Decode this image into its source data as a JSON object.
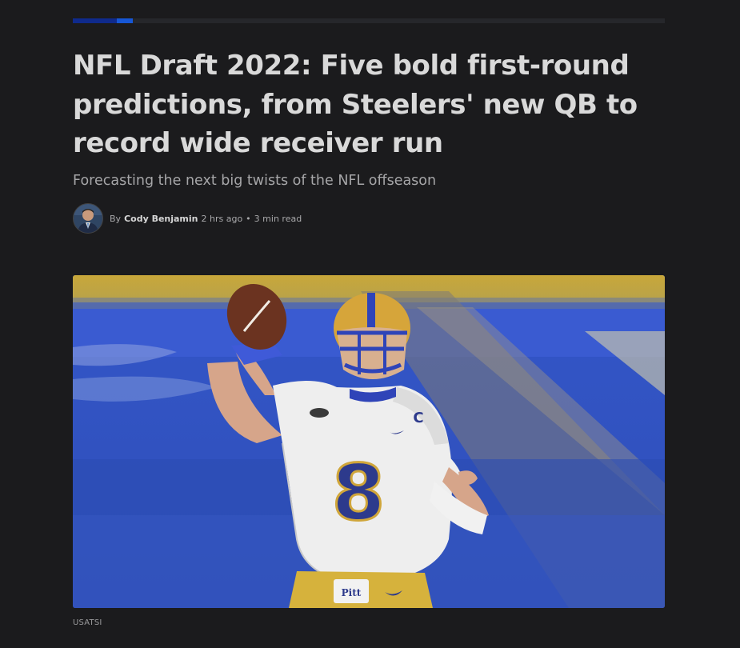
{
  "article": {
    "headline": "NFL Draft 2022: Five bold first-round predictions, from Steelers' new QB to record wide receiver run",
    "subheadline": "Forecasting the next big twists of the NFL offseason",
    "byline": {
      "prefix": "By",
      "author": "Cody Benjamin",
      "time_ago": "2 hrs ago",
      "separator": "•",
      "read_time": "3 min read"
    },
    "image": {
      "jersey_number": "8",
      "captain_letter": "C",
      "pants_logo": "Pitt",
      "credit": "USATSI"
    },
    "reading_progress": 0.1
  },
  "colors": {
    "background": "#1b1b1d",
    "progress_track": "#26272b",
    "progress_fill_dark": "#0f2a8c",
    "progress_fill_light": "#1657d6",
    "headline": "#d9d9d9",
    "subheadline": "#a6a6a8"
  }
}
